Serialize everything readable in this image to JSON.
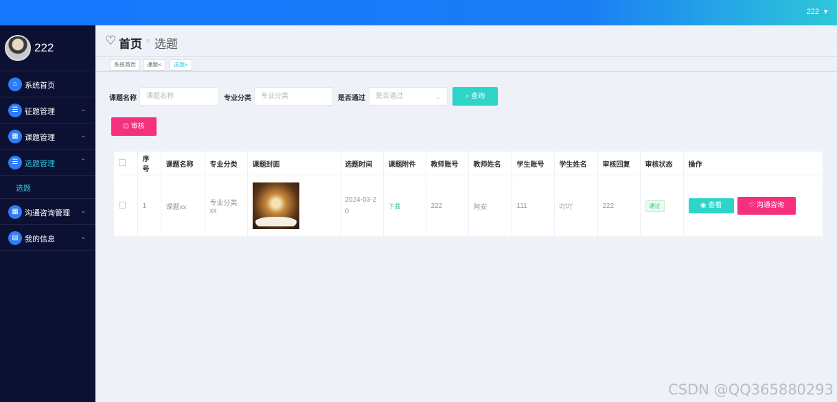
{
  "topbar": {
    "username": "222",
    "caret": "▼"
  },
  "sidebar": {
    "profile_name": "222",
    "items": [
      {
        "label": "系统首页",
        "icon": "⌂"
      },
      {
        "label": "征题管理",
        "icon": "☰",
        "arrow": "⌄"
      },
      {
        "label": "课题管理",
        "icon": "▦",
        "arrow": "⌄"
      },
      {
        "label": "选题管理",
        "icon": "☰",
        "arrow": "⌃"
      },
      {
        "label": "沟通咨询管理",
        "icon": "▦",
        "arrow": "⌄"
      },
      {
        "label": "我的信息",
        "icon": "▤",
        "arrow": "⌄"
      }
    ],
    "sub_item": "选题"
  },
  "header": {
    "heart": "♡",
    "home": "首页",
    "sep": "≡",
    "current": "选题"
  },
  "tabs": [
    {
      "label": "系统首页"
    },
    {
      "label": "课题×"
    },
    {
      "label": "选题×"
    }
  ],
  "filters": {
    "name_label": "课题名称",
    "name_placeholder": "课题名称",
    "category_label": "专业分类",
    "category_placeholder": "专业分类",
    "passed_label": "是否通过",
    "passed_placeholder": "是否通过",
    "dropdown_arrow": "⌄",
    "search_label": "⌕ 查询"
  },
  "audit_button": "⊡ 审核",
  "table": {
    "headers": [
      "序号",
      "课题名称",
      "专业分类",
      "课题封面",
      "选题时间",
      "课题附件",
      "教师账号",
      "教师姓名",
      "学生账号",
      "学生姓名",
      "审核回复",
      "审核状态",
      "操作"
    ],
    "row": {
      "index": "1",
      "name": "课题xx",
      "category": "专业分类xx",
      "time": "2024-03-20",
      "attachment": "下载",
      "teacher_account": "222",
      "teacher_name": "阿安",
      "student_account": "111",
      "student_name": "吖吖",
      "reply": "222",
      "status": "通过",
      "view_label": "◉ 查看",
      "chat_label": "♡ 沟通咨询"
    }
  },
  "watermark": "CSDN @QQ365880293",
  "colors": {
    "accent": "#2ec7d9",
    "pink": "#f5317f",
    "teal": "#2dd4c8",
    "sidebar": "#0c1133",
    "topbar": "#1677ff"
  }
}
